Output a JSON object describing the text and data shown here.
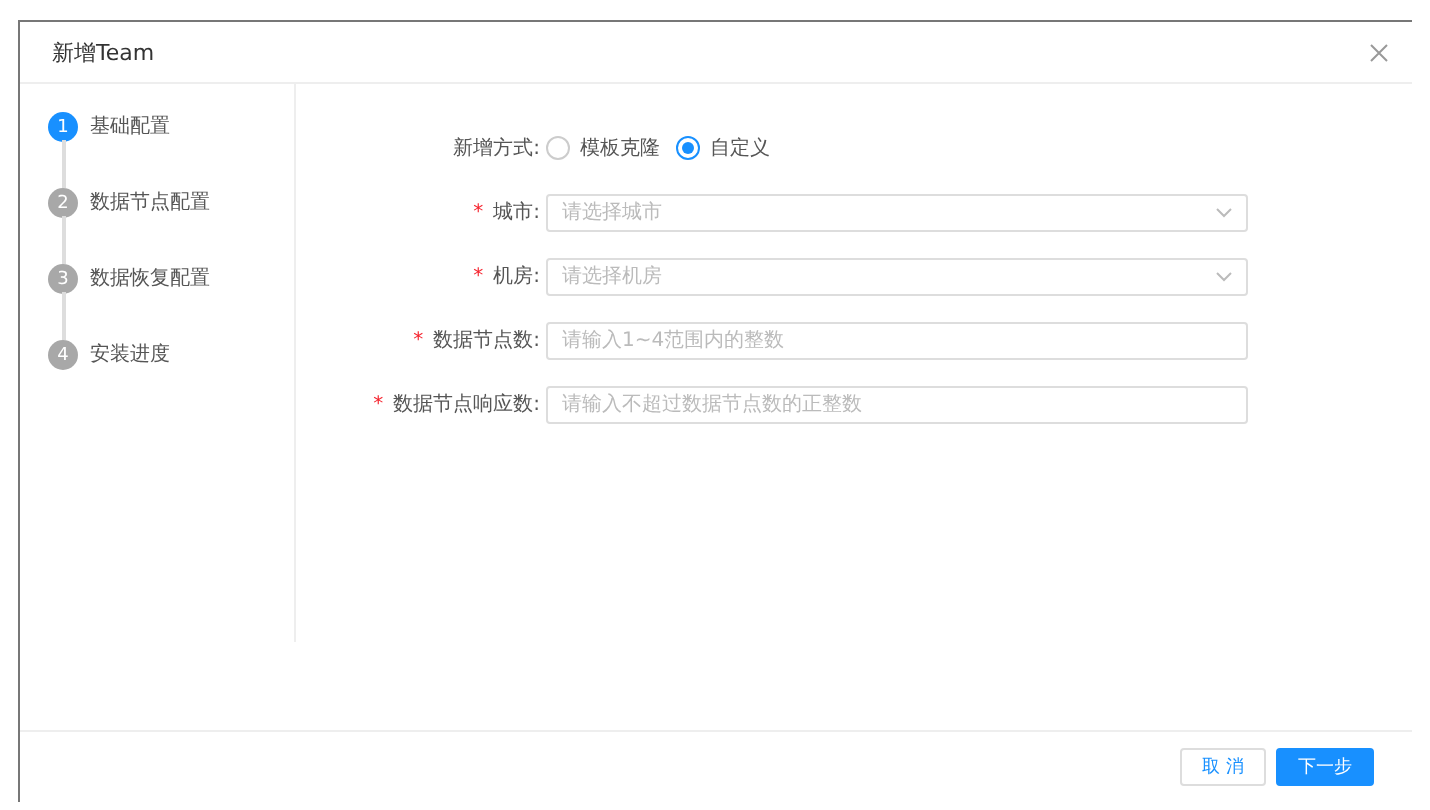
{
  "dialog": {
    "title": "新增Team"
  },
  "steps": [
    {
      "number": "1",
      "label": "基础配置",
      "selected": true
    },
    {
      "number": "2",
      "label": "数据节点配置",
      "selected": false
    },
    {
      "number": "3",
      "label": "数据恢复配置",
      "selected": false
    },
    {
      "number": "4",
      "label": "安装进度",
      "selected": false
    }
  ],
  "form": [
    {
      "kind": "radio",
      "label": "新增方式:",
      "options": [
        {
          "label": "模板克隆",
          "selected": false
        },
        {
          "label": "自定义",
          "selected": true
        }
      ]
    },
    {
      "kind": "select",
      "required_mark": "*",
      "label": "城市:",
      "placeholder": "请选择城市"
    },
    {
      "kind": "select",
      "required_mark": "*",
      "label": "机房:",
      "placeholder": "请选择机房"
    },
    {
      "kind": "input",
      "required_mark": "*",
      "label": "数据节点数:",
      "placeholder": "请输入1~4范围内的整数"
    },
    {
      "kind": "input",
      "required_mark": "*",
      "label": "数据节点响应数:",
      "placeholder": "请输入不超过数据节点数的正整数"
    }
  ],
  "buttons": [
    {
      "kind": "secondary",
      "label": "取 消"
    },
    {
      "kind": "primary",
      "label": "下一步"
    }
  ]
}
